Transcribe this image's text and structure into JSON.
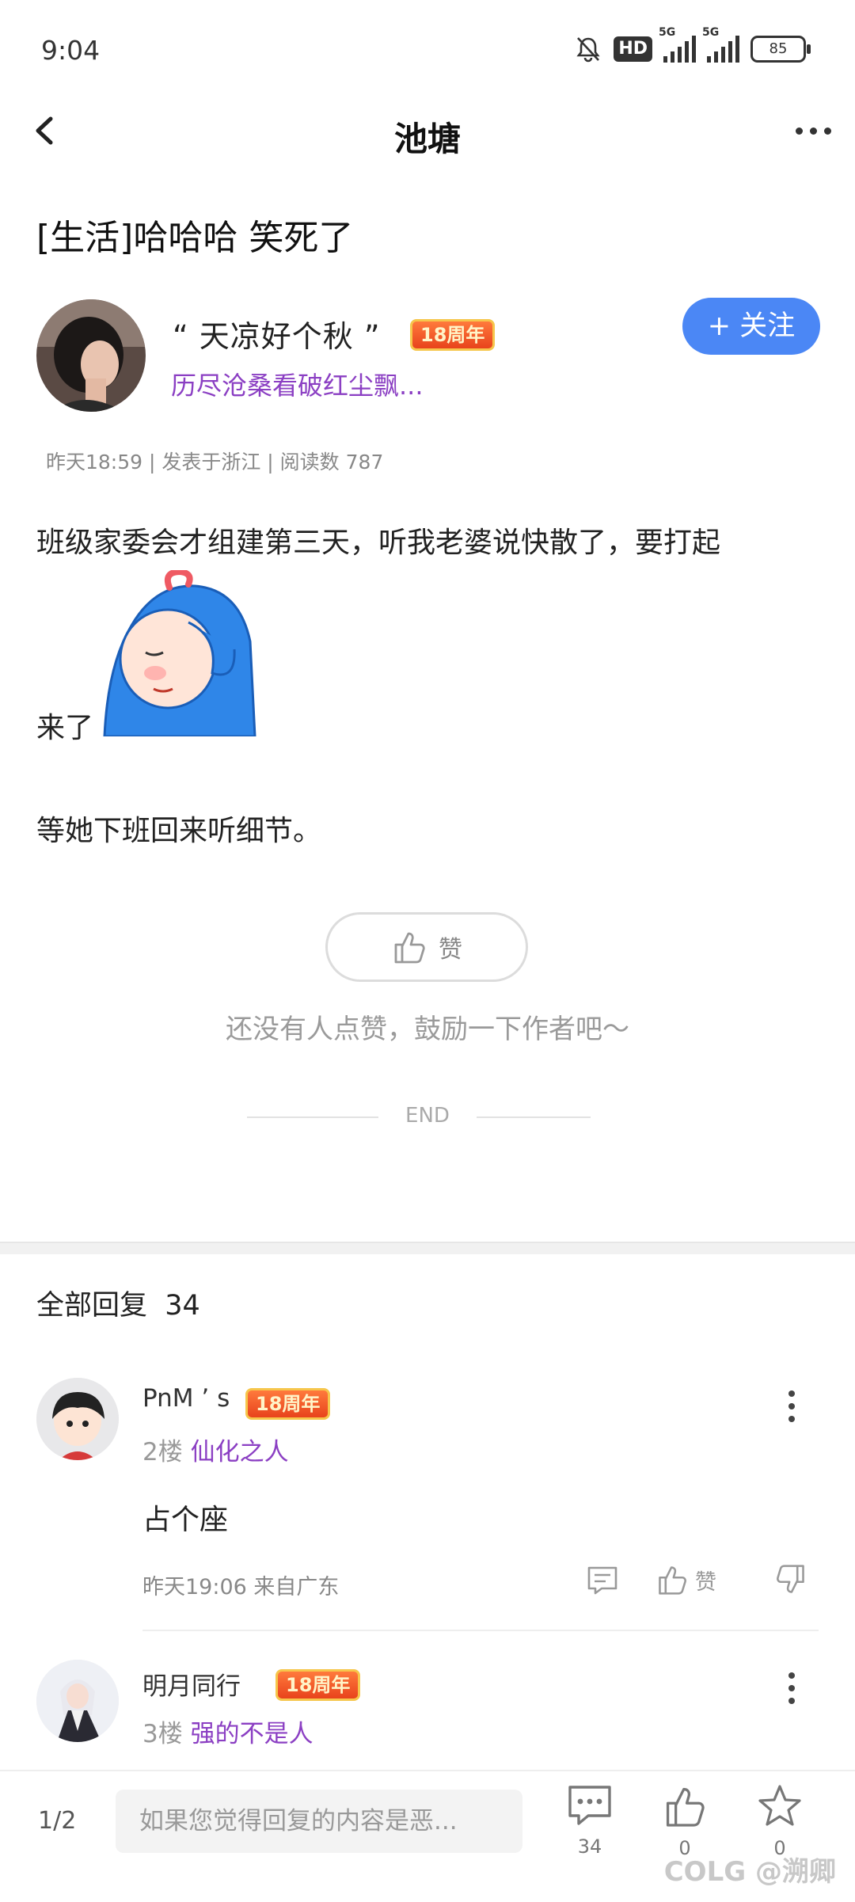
{
  "status_bar": {
    "time": "9:04",
    "hd": "HD",
    "net1": "5G",
    "net2": "5G",
    "battery": "85"
  },
  "header": {
    "title": "池塘"
  },
  "post": {
    "title": "[生活]哈哈哈 笑死了",
    "author": {
      "name": "“ 天凉好个秋 ”",
      "badge": "18周年",
      "signature": "历尽沧桑看破红尘飘...",
      "follow_label": "+ 关注"
    },
    "meta": "昨天18:59 | 发表于浙江 | 阅读数 787",
    "body_line1": "班级家委会才组建第三天，听我老婆说快散了，要打起",
    "body_line2": "来了",
    "body_line3": "等她下班回来听细节。"
  },
  "like": {
    "label": "赞",
    "hint": "还没有人点赞，鼓励一下作者吧～",
    "end": "END"
  },
  "replies": {
    "title": "全部回复",
    "count": "34",
    "items": [
      {
        "name": "PnM ’ s",
        "badge": "18周年",
        "floor": "2楼",
        "title": "仙化之人",
        "text": "占个座",
        "time": "昨天19:06 来自广东",
        "like_label": "赞"
      },
      {
        "name": "明月同行",
        "badge": "18周年",
        "floor": "3楼",
        "title": "强的不是人"
      }
    ]
  },
  "bottom_bar": {
    "pager": "1/2",
    "input_placeholder": "如果您觉得回复的内容是恶...",
    "comment_count": "34",
    "like_count": "0",
    "fav_count": "0",
    "watermark": "COLG @溯卿"
  }
}
